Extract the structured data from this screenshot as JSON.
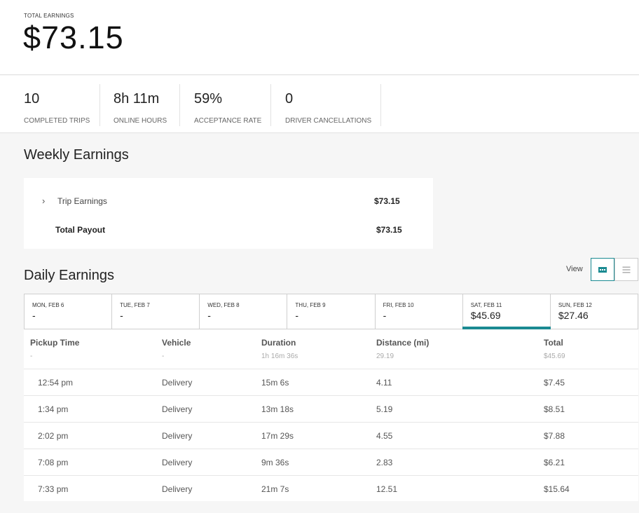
{
  "total": {
    "label": "TOTAL EARNINGS",
    "amount": "$73.15"
  },
  "stats": [
    {
      "value": "10",
      "label": "COMPLETED TRIPS"
    },
    {
      "value": "8h 11m",
      "label": "ONLINE HOURS"
    },
    {
      "value": "59%",
      "label": "ACCEPTANCE RATE"
    },
    {
      "value": "0",
      "label": "DRIVER CANCELLATIONS"
    }
  ],
  "weekly": {
    "title": "Weekly Earnings",
    "trip_label": "Trip Earnings",
    "trip_value": "$73.15",
    "payout_label": "Total Payout",
    "payout_value": "$73.15"
  },
  "daily": {
    "title": "Daily Earnings",
    "view_label": "View",
    "accent": "#1b8a92",
    "days": [
      {
        "label": "MON, FEB 6",
        "value": "-"
      },
      {
        "label": "TUE, FEB 7",
        "value": "-"
      },
      {
        "label": "WED, FEB 8",
        "value": "-"
      },
      {
        "label": "THU, FEB 9",
        "value": "-"
      },
      {
        "label": "FRI, FEB 10",
        "value": "-"
      },
      {
        "label": "SAT, FEB 11",
        "value": "$45.69",
        "active": true
      },
      {
        "label": "SUN, FEB 12",
        "value": "$27.46"
      }
    ]
  },
  "table": {
    "headers": [
      "Pickup Time",
      "Vehicle",
      "Duration",
      "Distance (mi)",
      "Total"
    ],
    "summary": [
      "-",
      "-",
      "1h 16m 36s",
      "29.19",
      "$45.69"
    ],
    "rows": [
      [
        "12:54 pm",
        "Delivery",
        "15m 6s",
        "4.11",
        "$7.45"
      ],
      [
        "1:34 pm",
        "Delivery",
        "13m 18s",
        "5.19",
        "$8.51"
      ],
      [
        "2:02 pm",
        "Delivery",
        "17m 29s",
        "4.55",
        "$7.88"
      ],
      [
        "7:08 pm",
        "Delivery",
        "9m 36s",
        "2.83",
        "$6.21"
      ],
      [
        "7:33 pm",
        "Delivery",
        "21m 7s",
        "12.51",
        "$15.64"
      ]
    ]
  }
}
